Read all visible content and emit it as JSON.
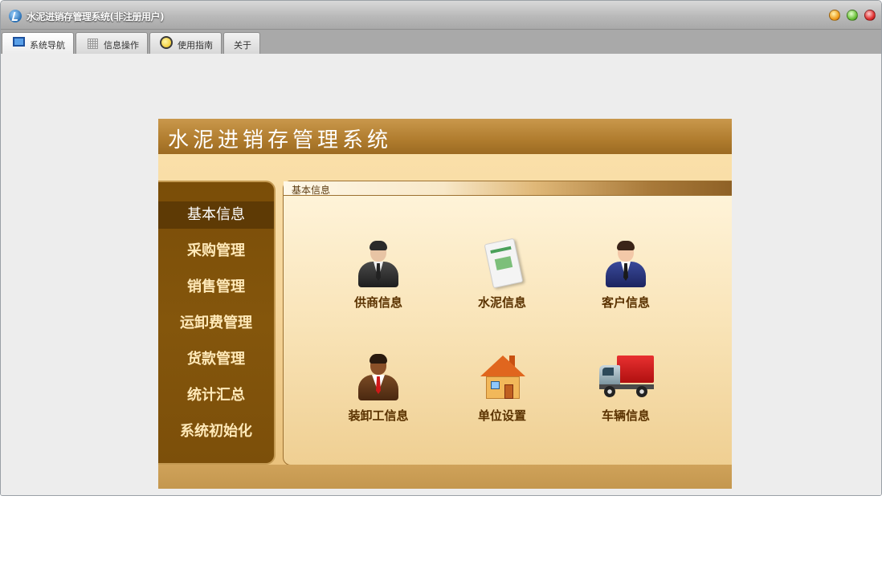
{
  "window": {
    "title": "水泥进销存管理系统(非注册用户)"
  },
  "tabs": [
    {
      "label": "系统导航",
      "icon": "monitor-icon",
      "active": true
    },
    {
      "label": "信息操作",
      "icon": "grid-icon",
      "active": false
    },
    {
      "label": "使用指南",
      "icon": "circle-icon",
      "active": false
    },
    {
      "label": "关于",
      "icon": "",
      "active": false
    }
  ],
  "panel": {
    "title": "水泥进销存管理系统"
  },
  "side_menu": {
    "items": [
      "基本信息",
      "采购管理",
      "销售管理",
      "运卸费管理",
      "货款管理",
      "统计汇总",
      "系统初始化"
    ],
    "active_index": 0
  },
  "main": {
    "tab_label": "基本信息",
    "items": [
      {
        "label": "供商信息",
        "icon": "supplier-person-icon"
      },
      {
        "label": "水泥信息",
        "icon": "cement-bag-icon"
      },
      {
        "label": "客户信息",
        "icon": "customer-person-icon"
      },
      {
        "label": "装卸工信息",
        "icon": "worker-person-icon"
      },
      {
        "label": "单位设置",
        "icon": "house-icon"
      },
      {
        "label": "车辆信息",
        "icon": "truck-icon"
      }
    ]
  },
  "colors": {
    "menu_bg": "#7a4d08",
    "menu_active_bg": "#5e3a05",
    "panel_header": "#b07c2e",
    "caption_text": "#5a3200"
  }
}
